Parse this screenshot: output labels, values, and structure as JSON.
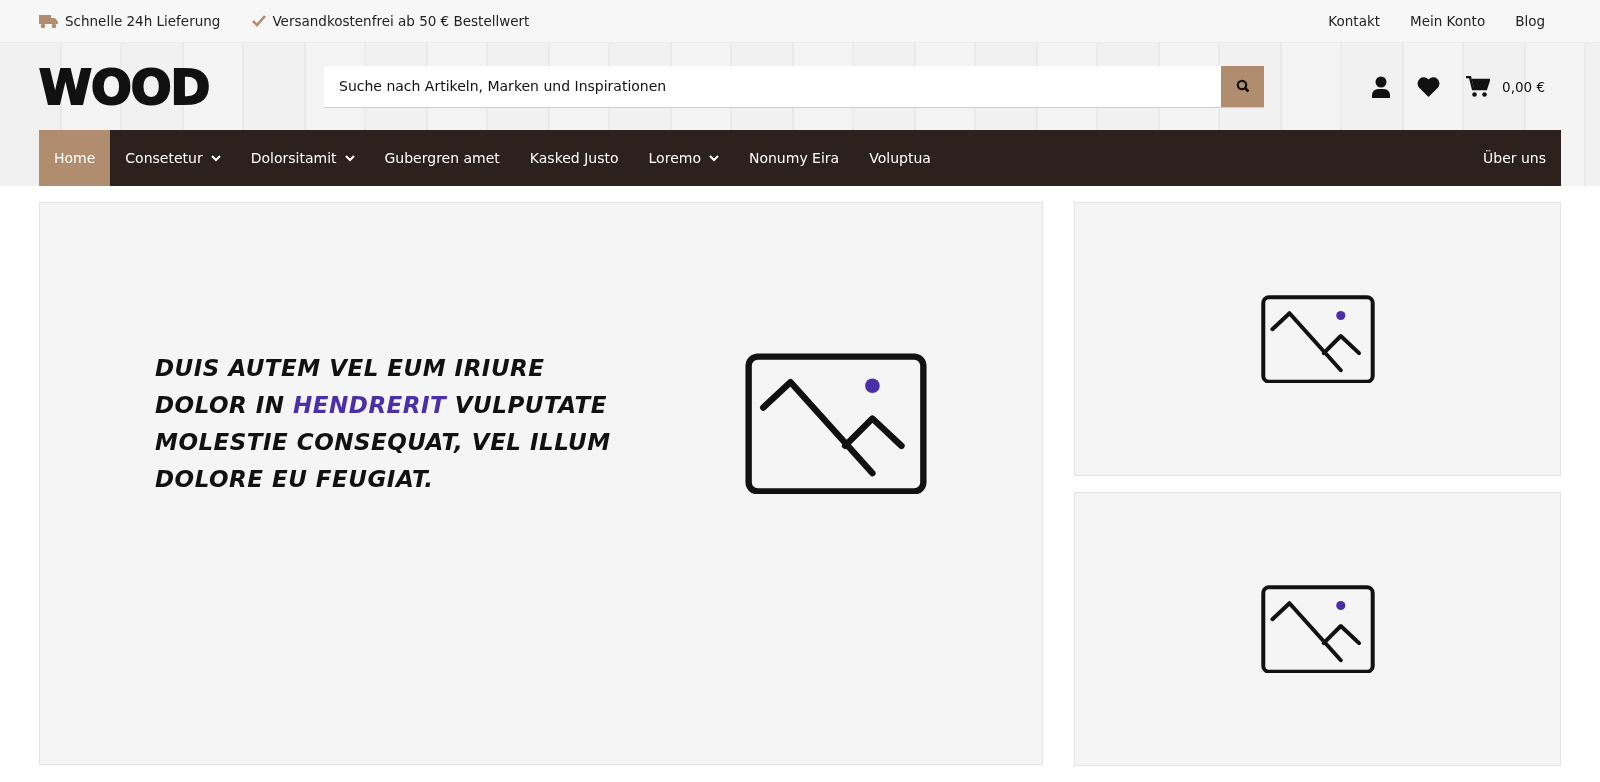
{
  "top_bar": {
    "usps": [
      {
        "kind": "truck",
        "text": "Schnelle 24h Lieferung"
      },
      {
        "kind": "check",
        "text": "Versandkostenfrei ab 50 € Bestellwert"
      }
    ],
    "links": [
      "Kontakt",
      "Mein Konto",
      "Blog"
    ]
  },
  "header": {
    "logo": "WOOD",
    "search": {
      "placeholder": "Suche nach Artikeln, Marken und Inspirationen"
    },
    "cart_total": "0,00 €"
  },
  "nav": {
    "items": [
      {
        "label": "Home",
        "selected": true,
        "dropdown": false
      },
      {
        "label": "Consetetur",
        "selected": false,
        "dropdown": true
      },
      {
        "label": "Dolorsitamit",
        "selected": false,
        "dropdown": true
      },
      {
        "label": "Gubergren amet",
        "selected": false,
        "dropdown": false
      },
      {
        "label": "Kasked Justo",
        "selected": false,
        "dropdown": false
      },
      {
        "label": "Loremo",
        "selected": false,
        "dropdown": true
      },
      {
        "label": "Nonumy Eira",
        "selected": false,
        "dropdown": false
      },
      {
        "label": "Voluptua",
        "selected": false,
        "dropdown": false
      }
    ],
    "right_item": "Über uns"
  },
  "banner": {
    "headline": {
      "before": "DUIS AUTEM VEL EUM IRIURE DOLOR IN ",
      "highlight": "HENDRERIT",
      "after": " VULPUTATE MOLESTIE CONSEQUAT, VEL ILLUM DOLORE EU FEUGIAT."
    },
    "image": {
      "kind": "placeholder"
    }
  },
  "side_cards": [
    {
      "image": {
        "kind": "placeholder"
      }
    },
    {
      "image": {
        "kind": "placeholder"
      }
    }
  ]
}
